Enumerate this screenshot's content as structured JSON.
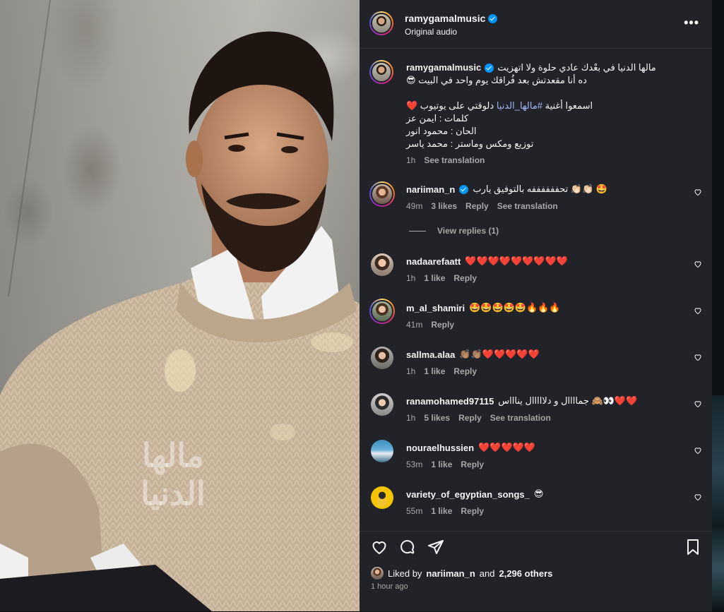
{
  "media": {
    "watermark": "مالها الدنيا"
  },
  "header": {
    "username": "ramygamalmusic",
    "subtitle": "Original audio",
    "more": "•••"
  },
  "caption": {
    "username": "ramygamalmusic",
    "line1": "مالها الدنيا في بعْدك عادي حلوة ولا اتهزيت",
    "line2": "ده أنا مقعدتش بعد فُراقك يوم واحد في البيت 😎",
    "line3_pre": "اسمعوا أغنية ",
    "line3_tag": "#مالها_الدنيا",
    "line3_post": " دلوقتي على يوتيوب ❤️",
    "line4": "كلمات : ايمن عز",
    "line5": "الحان : محمود انور",
    "line6": "توزيع ومكس وماستر : محمد ياسر",
    "time": "1h",
    "see_translation": "See translation"
  },
  "comments": [
    {
      "user": "nariiman_n",
      "verified": true,
      "text": "تحففففففه بالتوفيق يارب 👏🏻👏🏻 🤩",
      "time": "49m",
      "likes": "3 likes",
      "reply": "Reply",
      "translate": "See translation"
    },
    {
      "user": "nadaarefaatt",
      "text": "❤️❤️❤️❤️❤️❤️❤️❤️❤️",
      "time": "1h",
      "likes": "1 like",
      "reply": "Reply"
    },
    {
      "user": "m_al_shamiri",
      "text": "🤩🤩🤩🤩🤩🔥🔥🔥",
      "time": "41m",
      "reply": "Reply"
    },
    {
      "user": "sallma.alaa",
      "text": "👏🏽👏🏽❤️❤️❤️❤️❤️",
      "time": "1h",
      "likes": "1 like",
      "reply": "Reply"
    },
    {
      "user": "ranamohamed97115",
      "text": "جماااال و دلااااال يناااس 🙈👀❤️❤️",
      "time": "1h",
      "likes": "5 likes",
      "reply": "Reply",
      "translate": "See translation"
    },
    {
      "user": "nouraelhussien",
      "text": "❤️❤️❤️❤️❤️",
      "time": "53m",
      "likes": "1 like",
      "reply": "Reply"
    },
    {
      "user": "variety_of_egyptian_songs_",
      "text": "😎",
      "time": "55m",
      "likes": "1 like",
      "reply": "Reply"
    }
  ],
  "view_replies": "View replies (1)",
  "footer": {
    "liked_by_prefix": "Liked by",
    "liked_by_user": "nariiman_n",
    "liked_and": "and",
    "others": "2,296 others",
    "time": "1 hour ago"
  },
  "colors": {
    "panel_bg": "#212328",
    "link": "#a3b7f7",
    "verified": "#0095f6",
    "secondary_text": "#a8a8a8"
  }
}
